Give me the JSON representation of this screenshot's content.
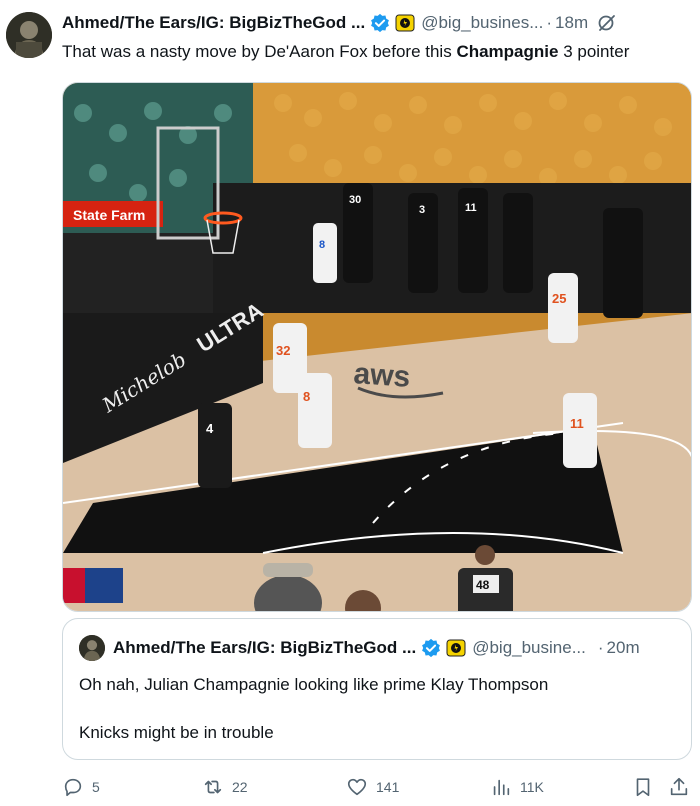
{
  "tweet": {
    "author_name": "Ahmed/The Ears/IG: BigBizTheGod ...",
    "handle": "@big_busines...",
    "separator": "·",
    "time": "18m",
    "text_before": "That was a nasty move by De'Aaron Fox before this ",
    "text_bold": "Champagnie",
    "text_after": " 3 pointer"
  },
  "media": {
    "sponsor_left": "State Farm",
    "court_logo": "aws",
    "court_text_ultra": "ULTRA",
    "court_text_michelob": "Michelob",
    "referee_number": "48",
    "players": [
      {
        "number": "8"
      },
      {
        "number": "32"
      },
      {
        "number": "25"
      },
      {
        "number": "11"
      },
      {
        "number": "4"
      },
      {
        "number": "30"
      },
      {
        "number": "3"
      },
      {
        "number": "11"
      }
    ]
  },
  "quote": {
    "author_name": "Ahmed/The Ears/IG: BigBizTheGod ...",
    "handle": "@big_busine...",
    "separator": "·",
    "time": "20m",
    "text": "Oh nah, Julian Champagnie looking like prime Klay Thompson\n\nKnicks might be in trouble"
  },
  "actions": {
    "replies": "5",
    "reposts": "22",
    "likes": "141",
    "views": "11K"
  },
  "colors": {
    "text": "#0f1419",
    "secondary": "#536471",
    "border": "#cfd9de",
    "verified": "#1d9bf0",
    "affiliate_badge": "#f5d300"
  }
}
